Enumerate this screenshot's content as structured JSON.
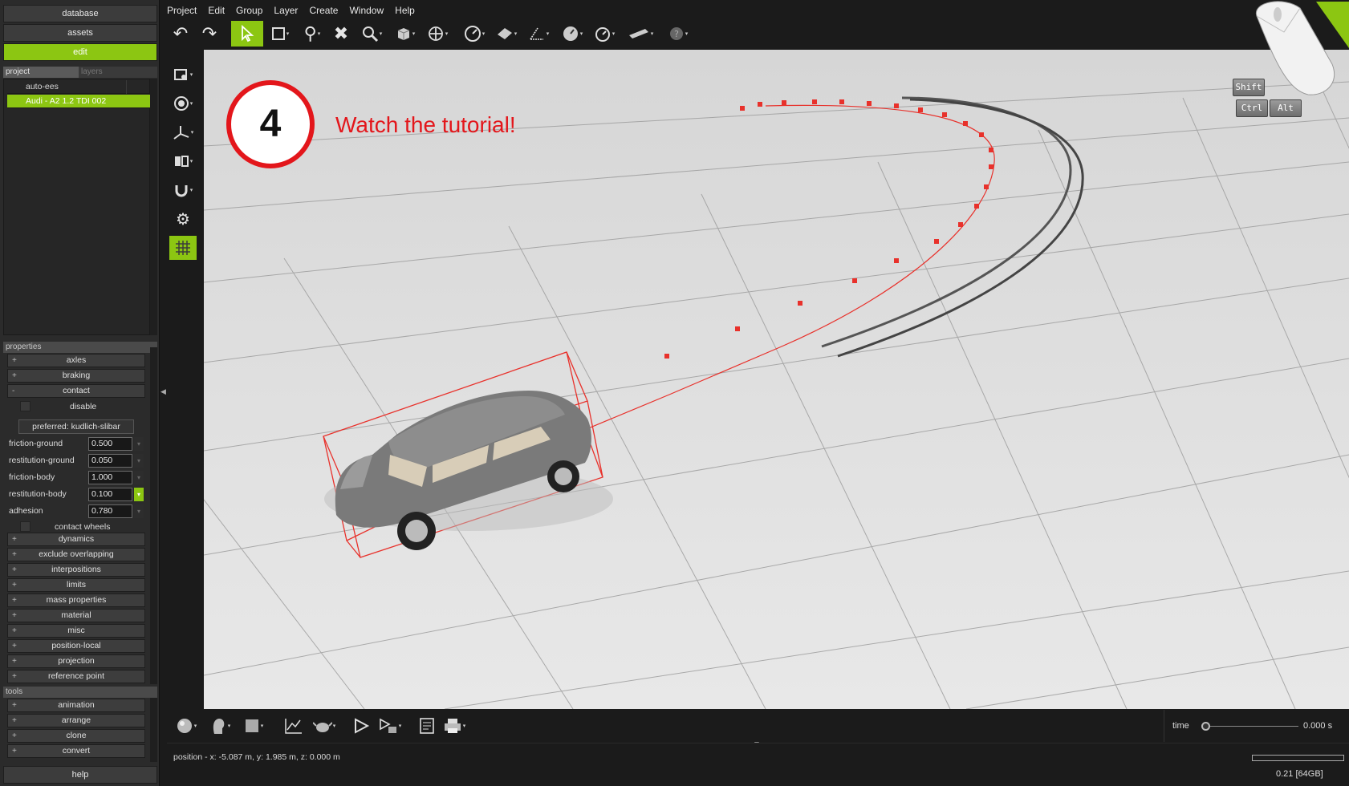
{
  "nav": {
    "database": "database",
    "assets": "assets",
    "edit": "edit"
  },
  "tabs": {
    "project": "project",
    "layers": "layers"
  },
  "tree": [
    "auto-ees",
    "Audi - A2 1.2 TDI 002"
  ],
  "properties": {
    "header": "properties",
    "groups_top": [
      "axles",
      "braking",
      "contact"
    ],
    "contact": {
      "disable_label": "disable",
      "preferred": "preferred: kudlich-slibar",
      "fields": [
        {
          "label": "friction-ground",
          "value": "0.500"
        },
        {
          "label": "restitution-ground",
          "value": "0.050"
        },
        {
          "label": "friction-body",
          "value": "1.000"
        },
        {
          "label": "restitution-body",
          "value": "0.100"
        },
        {
          "label": "adhesion",
          "value": "0.780"
        }
      ],
      "contact_wheels_label": "contact wheels"
    },
    "groups_bottom": [
      "dynamics",
      "exclude overlapping",
      "interpositions",
      "limits",
      "mass properties",
      "material",
      "misc",
      "position-local",
      "projection",
      "reference point"
    ]
  },
  "tools": {
    "header": "tools",
    "items": [
      "animation",
      "arrange",
      "clone",
      "convert"
    ]
  },
  "help": "help",
  "menu": [
    "Project",
    "Edit",
    "Group",
    "Layer",
    "Create",
    "Window",
    "Help"
  ],
  "toolbar_icons": [
    "undo-icon",
    "redo-icon",
    "select-arrow-icon",
    "selection-box-icon",
    "pin-icon",
    "delete-icon",
    "zoom-icon",
    "cube-view-icon",
    "move-icon",
    "gauge-icon",
    "plane-icon",
    "measure-icon",
    "dial-icon",
    "stopwatch-icon",
    "ruler-icon",
    "help-circle-icon"
  ],
  "overlay": {
    "step_number": "4",
    "step_text": "Watch the tutorial!"
  },
  "keys": {
    "shift": "Shift",
    "ctrl": "Ctrl",
    "alt": "Alt"
  },
  "time": {
    "label": "time",
    "value": "0.000 s",
    "progress": 0.0
  },
  "status": {
    "position": "position - x: -5.087 m, y: 1.985 m, z: 0.000 m",
    "memory": "0.21 [64GB]"
  },
  "colors": {
    "accent": "#8cc612",
    "tutorial_red": "#e3161b",
    "trajectory_red": "#e8312b"
  }
}
